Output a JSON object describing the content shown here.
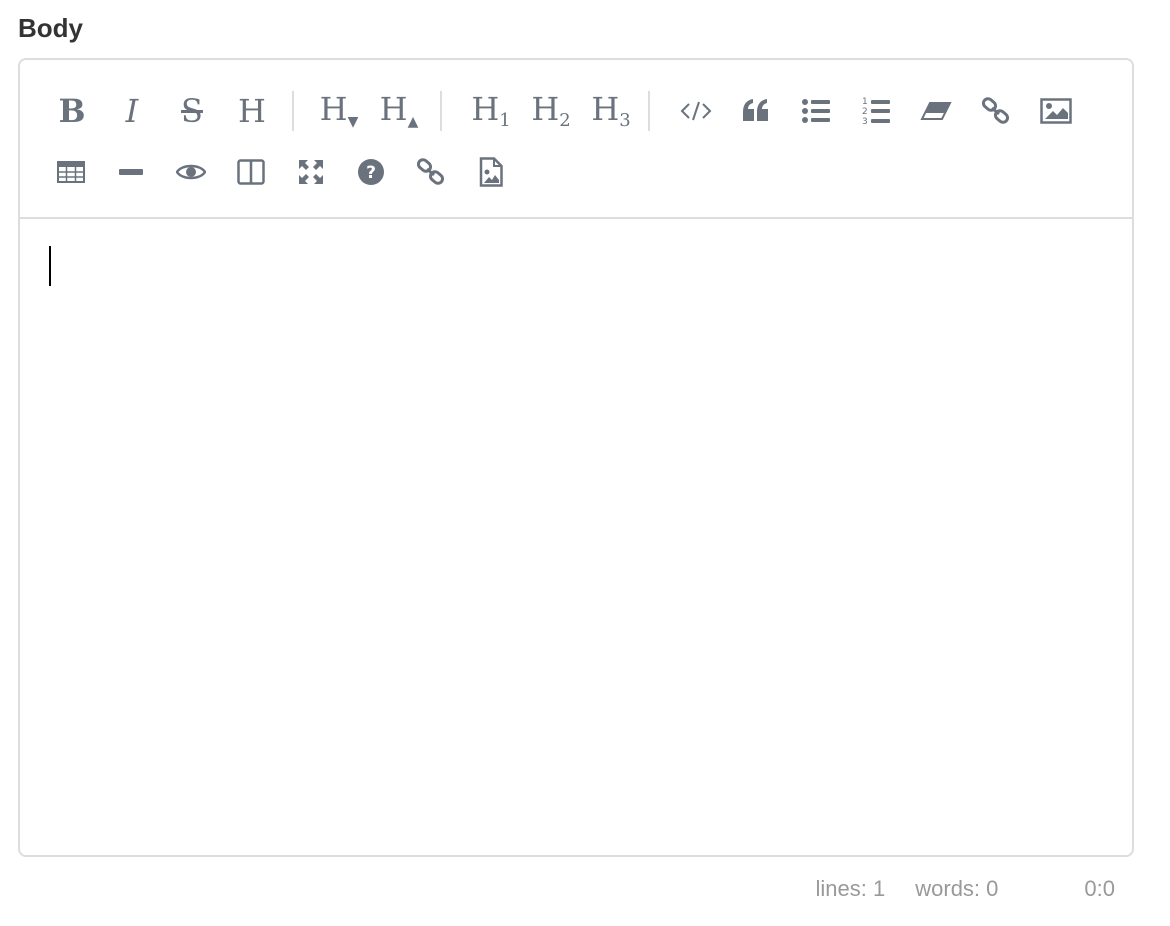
{
  "field": {
    "label": "Body"
  },
  "toolbar": {
    "buttons": [
      {
        "name": "bold",
        "text": "B",
        "title": "Bold"
      },
      {
        "name": "italic",
        "text": "I",
        "title": "Italic"
      },
      {
        "name": "strikethrough",
        "text": "S",
        "title": "Strikethrough"
      },
      {
        "name": "heading",
        "text": "H",
        "title": "Heading"
      },
      {
        "name": "heading-smaller",
        "text": "H",
        "title": "Smaller Heading"
      },
      {
        "name": "heading-bigger",
        "text": "H",
        "title": "Bigger Heading"
      },
      {
        "name": "heading-1",
        "text": "H",
        "sub": "1",
        "title": "Big Heading"
      },
      {
        "name": "heading-2",
        "text": "H",
        "sub": "2",
        "title": "Medium Heading"
      },
      {
        "name": "heading-3",
        "text": "H",
        "sub": "3",
        "title": "Small Heading"
      },
      {
        "name": "code",
        "icon": "code-icon",
        "title": "Code"
      },
      {
        "name": "quote",
        "icon": "quote-icon",
        "title": "Quote"
      },
      {
        "name": "unordered-list",
        "icon": "bullet-list-icon",
        "title": "Generic List"
      },
      {
        "name": "ordered-list",
        "icon": "numbered-list-icon",
        "title": "Numbered List"
      },
      {
        "name": "clean-block",
        "icon": "eraser-icon",
        "title": "Clean block"
      },
      {
        "name": "link",
        "icon": "link-icon",
        "title": "Create Link"
      },
      {
        "name": "image",
        "icon": "image-icon",
        "title": "Insert Image"
      },
      {
        "name": "table",
        "icon": "table-icon",
        "title": "Insert Table"
      },
      {
        "name": "horizontal-rule",
        "icon": "minus-icon",
        "title": "Insert Horizontal Line"
      },
      {
        "name": "preview",
        "icon": "eye-icon",
        "title": "Toggle Preview"
      },
      {
        "name": "side-by-side",
        "icon": "columns-icon",
        "title": "Toggle Side by Side"
      },
      {
        "name": "fullscreen",
        "icon": "expand-icon",
        "title": "Toggle Fullscreen"
      },
      {
        "name": "guide",
        "icon": "question-circle-icon",
        "title": "Markdown Guide"
      },
      {
        "name": "link-alt",
        "icon": "link-icon",
        "title": "Link"
      },
      {
        "name": "upload-image",
        "icon": "file-image-icon",
        "title": "Upload Image"
      }
    ]
  },
  "editor": {
    "value": ""
  },
  "status": {
    "lines": "lines: 1",
    "words": "words: 0",
    "cursor": "0:0"
  },
  "colors": {
    "icon": "#6a737d",
    "border": "#dddddd",
    "status_text": "#999999",
    "label_text": "#333333"
  }
}
